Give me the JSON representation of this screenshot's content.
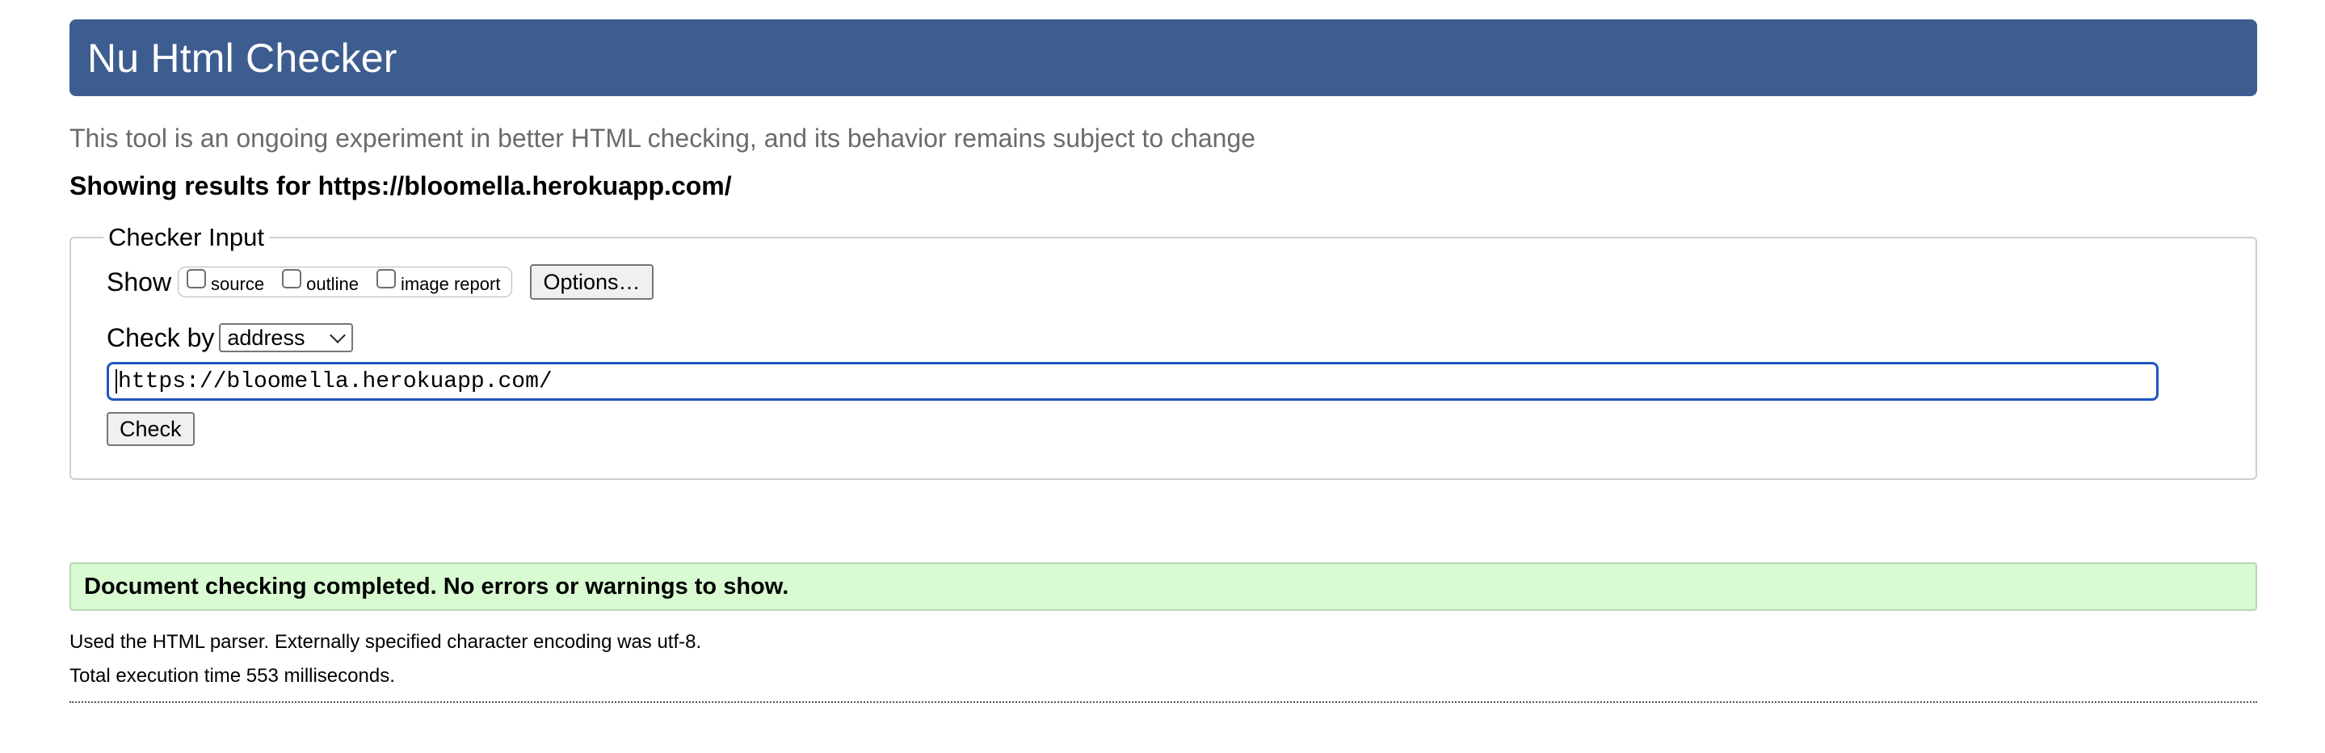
{
  "header": {
    "title": "Nu Html Checker",
    "subtitle": "This tool is an ongoing experiment in better HTML checking, and its behavior remains subject to change"
  },
  "results_for": "Showing results for https://bloomella.herokuapp.com/",
  "checker_input": {
    "legend": "Checker Input",
    "show_label": "Show",
    "show_options": [
      {
        "label": "source",
        "checked": false
      },
      {
        "label": "outline",
        "checked": false
      },
      {
        "label": "image report",
        "checked": false
      }
    ],
    "options_button": "Options…",
    "check_by_label": "Check by",
    "check_by_selected": "address",
    "url_value": "https://bloomella.herokuapp.com/",
    "check_button": "Check"
  },
  "result": {
    "message": "Document checking completed. No errors or warnings to show.",
    "parser_info": "Used the HTML parser. Externally specified character encoding was utf-8.",
    "execution_time": "Total execution time 553 milliseconds."
  },
  "colors": {
    "banner": "#3d5d91",
    "success_bg": "#d8fbd2",
    "input_focus": "#1f56c3"
  }
}
